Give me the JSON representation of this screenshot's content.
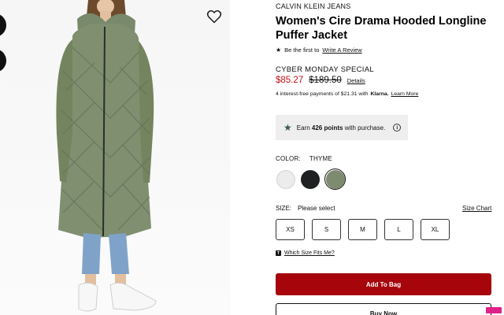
{
  "product": {
    "brand": "CALVIN KLEIN JEANS",
    "title": "Women's Cire Drama Hooded Longline Puffer Jacket",
    "review_prompt": "Be the first to",
    "review_link": "Write A Review",
    "promo": "CYBER MONDAY SPECIAL",
    "sale_price": "$85.27",
    "original_price": "$189.50",
    "details_link": "Details",
    "installments_text": "4 interest-free payments of $21.31 with",
    "installments_provider": "Klarna.",
    "learn_more": "Learn More"
  },
  "points": {
    "prefix": "Earn",
    "amount": "426 points",
    "suffix": "with purchase."
  },
  "color": {
    "label": "COLOR:",
    "selected": "THYME",
    "swatches": [
      {
        "name": "white",
        "hex": "#ececec"
      },
      {
        "name": "black",
        "hex": "#1f2123"
      },
      {
        "name": "thyme",
        "hex": "#7d8b71",
        "selected": true
      }
    ]
  },
  "size": {
    "label": "SIZE:",
    "selected_text": "Please select",
    "chart_link": "Size Chart",
    "options": [
      "XS",
      "S",
      "M",
      "L",
      "XL"
    ],
    "fit_link": "Which Size Fits Me?"
  },
  "actions": {
    "add_to_bag": "Add To Bag",
    "buy_now": "Buy Now"
  },
  "colors": {
    "accent_red": "#a6050c",
    "sale_red": "#c01018",
    "points_bg": "#eeeeee"
  },
  "icons": {
    "favorite": "heart-outline-icon",
    "review_star": "star-icon",
    "points_star": "star-icon",
    "info": "info-icon",
    "fit": "ruler-icon"
  }
}
